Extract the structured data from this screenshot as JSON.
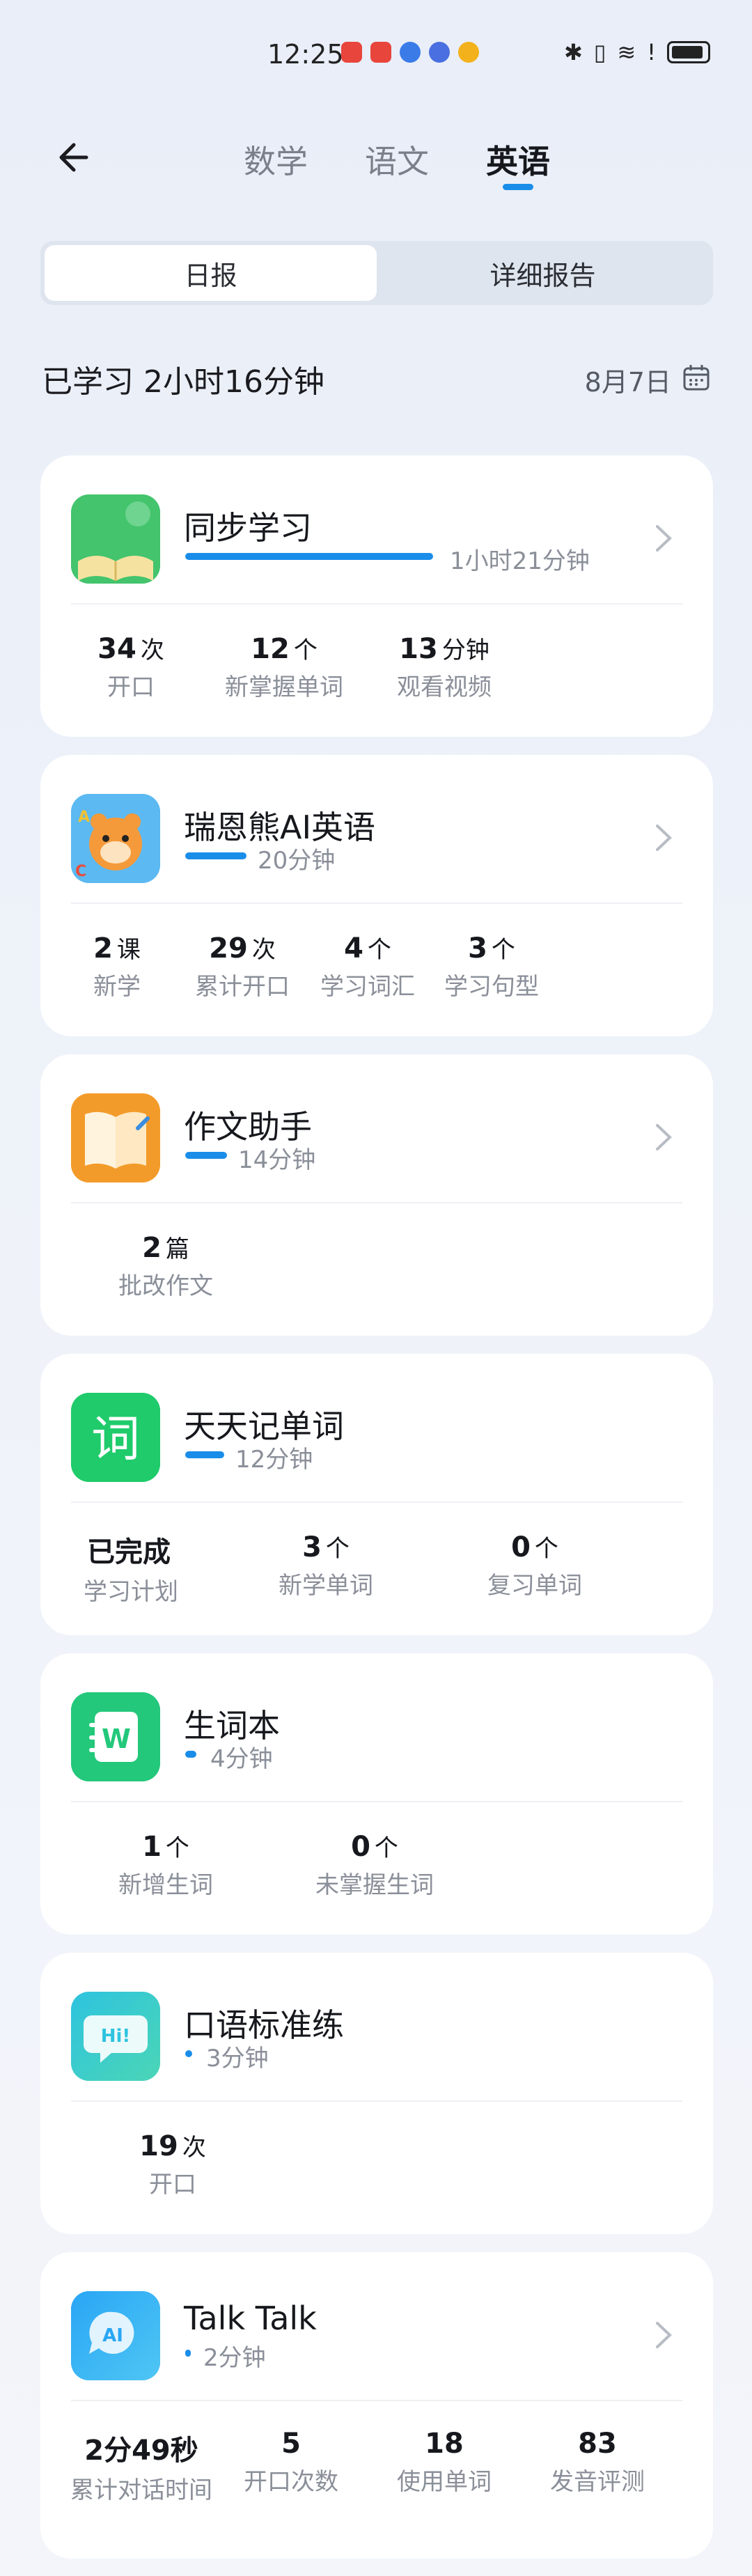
{
  "status_bar": {
    "time": "12:25"
  },
  "nav": {
    "tabs": [
      {
        "label": "数学"
      },
      {
        "label": "语文"
      },
      {
        "label": "英语"
      }
    ],
    "active_tab": "英语"
  },
  "segment": {
    "daily": "日报",
    "detail": "详细报告"
  },
  "summary": {
    "studied": "已学习 2小时16分钟",
    "date": "8月7日"
  },
  "cards": [
    {
      "title": "同步学习",
      "duration": "1小时21分钟",
      "progress": 1.0,
      "stats": [
        {
          "value": "34",
          "unit": "次",
          "label": "开口"
        },
        {
          "value": "12",
          "unit": "个",
          "label": "新掌握单词"
        },
        {
          "value": "13",
          "unit": "分钟",
          "label": "观看视频"
        }
      ]
    },
    {
      "title": "瑞恩熊AI英语",
      "duration": "20分钟",
      "progress": 0.25,
      "stats": [
        {
          "value": "2",
          "unit": "课",
          "label": "新学"
        },
        {
          "value": "29",
          "unit": "次",
          "label": "累计开口"
        },
        {
          "value": "4",
          "unit": "个",
          "label": "学习词汇"
        },
        {
          "value": "3",
          "unit": "个",
          "label": "学习句型"
        }
      ]
    },
    {
      "title": "作文助手",
      "duration": "14分钟",
      "progress": 0.17,
      "stats": [
        {
          "value": "2",
          "unit": "篇",
          "label": "批改作文"
        }
      ]
    },
    {
      "title": "天天记单词",
      "duration": "12分钟",
      "progress": 0.15,
      "stats": [
        {
          "value": "已完成",
          "unit": "",
          "label": "学习计划"
        },
        {
          "value": "3",
          "unit": "个",
          "label": "新学单词"
        },
        {
          "value": "0",
          "unit": "个",
          "label": "复习单词"
        }
      ]
    },
    {
      "title": "生词本",
      "duration": "4分钟",
      "progress": 0.05,
      "stats": [
        {
          "value": "1",
          "unit": "个",
          "label": "新增生词"
        },
        {
          "value": "0",
          "unit": "个",
          "label": "未掌握生词"
        }
      ]
    },
    {
      "title": "口语标准练",
      "duration": "3分钟",
      "progress": 0.04,
      "stats": [
        {
          "value": "19",
          "unit": "次",
          "label": "开口"
        }
      ]
    },
    {
      "title": "Talk Talk",
      "duration": "2分钟",
      "progress": 0.03,
      "stats": [
        {
          "value": "2分49秒",
          "unit": "",
          "label": "累计对话时间"
        },
        {
          "value": "5",
          "unit": "",
          "label": "开口次数"
        },
        {
          "value": "18",
          "unit": "",
          "label": "使用单词"
        },
        {
          "value": "83",
          "unit": "",
          "label": "发音评测"
        }
      ]
    }
  ]
}
